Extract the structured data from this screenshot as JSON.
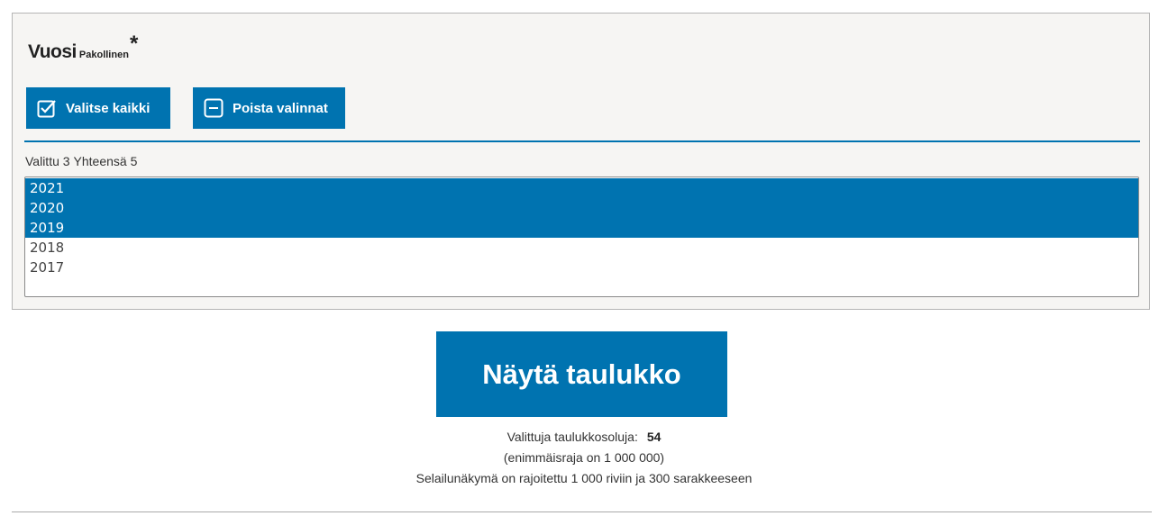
{
  "variable": {
    "title": "Vuosi",
    "required_label": "Pakollinen",
    "required_mark": "*"
  },
  "buttons": {
    "select_all": "Valitse kaikki",
    "clear_selection": "Poista valinnat"
  },
  "selection_count": {
    "selected_label": "Valittu 3",
    "total_label": "Yhteensä 5"
  },
  "options": [
    {
      "label": "2021",
      "selected": true
    },
    {
      "label": "2020",
      "selected": true
    },
    {
      "label": "2019",
      "selected": true
    },
    {
      "label": "2018",
      "selected": false
    },
    {
      "label": "2017",
      "selected": false
    }
  ],
  "show_table_button": "Näytä taulukko",
  "summary": {
    "cells_label": "Valittuja taulukkosoluja:",
    "cells_value": "54",
    "limit_text": "(enimmäisraja on 1 000 000)",
    "view_limit_text": "Selailunäkymä on rajoitettu 1 000 riviin ja 300 sarakkeeseen"
  },
  "colors": {
    "accent": "#0073b0",
    "panel_bg": "#f6f5f3"
  },
  "icons": {
    "select_all": "checkbox-checked-icon",
    "clear_selection": "checkbox-minus-icon"
  }
}
